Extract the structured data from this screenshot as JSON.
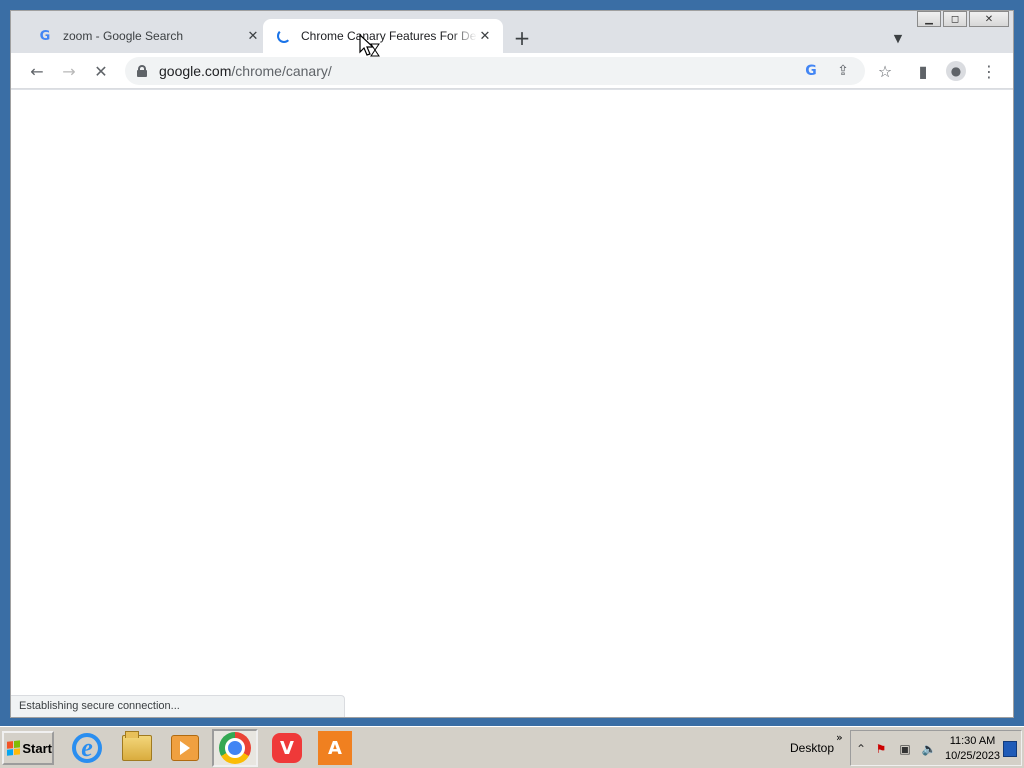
{
  "browser": {
    "tabs": [
      {
        "title": "zoom - Google Search",
        "favicon": "google-g-icon",
        "active": false
      },
      {
        "title": "Chrome Canary Features For Developers",
        "favicon": "loading-spinner-icon",
        "active": true
      }
    ],
    "new_tab_symbol": "+",
    "tab_close_symbol": "✕",
    "url_domain": "google.com",
    "url_path": "/chrome/canary/",
    "status_text": "Establishing secure connection...",
    "window_buttons": {
      "minimize": "▁",
      "maximize": "◻",
      "close": "✕"
    }
  },
  "taskbar": {
    "start_label": "Start",
    "desktop_label": "Desktop",
    "expand_symbol": "»",
    "apps": [
      "internet-explorer",
      "file-explorer",
      "media-player",
      "chrome",
      "vivaldi",
      "avast"
    ],
    "clock_time": "11:30 AM",
    "clock_date": "10/25/2023"
  },
  "colors": {
    "desktop": "#3a6ea5",
    "tabstrip": "#dee1e6",
    "accent": "#1a73e8"
  }
}
